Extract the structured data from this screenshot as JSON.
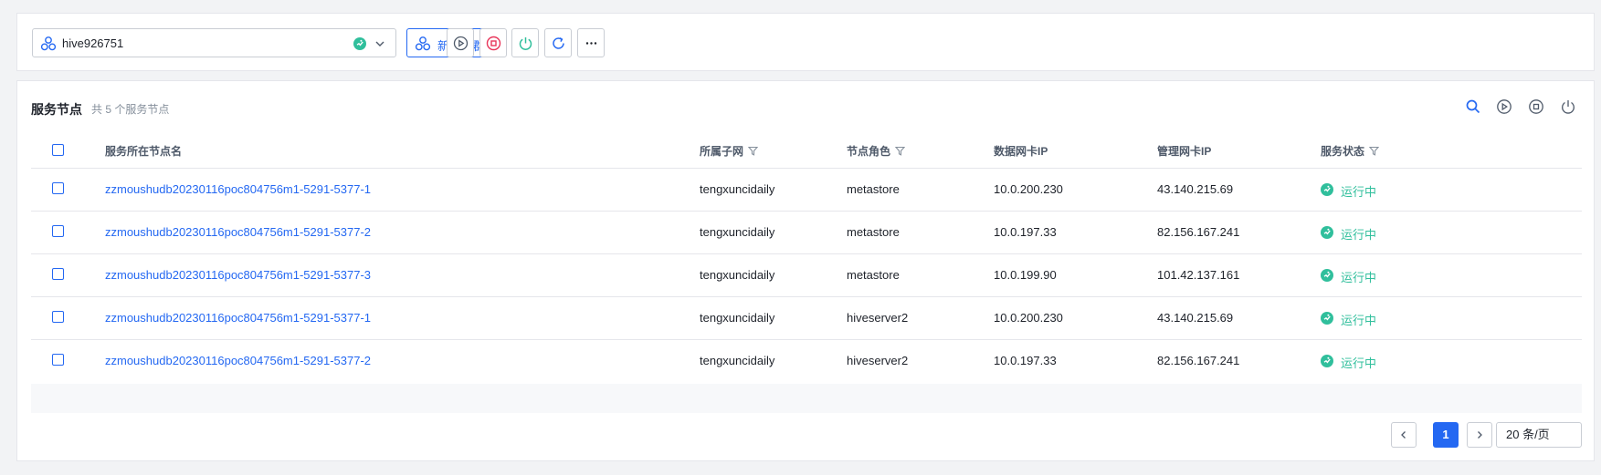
{
  "toolbar": {
    "cluster_name": "hive926751",
    "new_cluster_label": "新建集群",
    "icons": [
      "cluster-icon",
      "running-status-icon",
      "chevron-down-icon",
      "start-icon",
      "stop-icon",
      "power-icon",
      "refresh-icon",
      "more-icon"
    ]
  },
  "panel": {
    "title": "服务节点",
    "count_text": "共 5 个服务节点",
    "tool_icons": [
      "search-icon",
      "start-icon",
      "stop-icon",
      "power-icon"
    ]
  },
  "table": {
    "headers": {
      "node_name": "服务所在节点名",
      "subnet": "所属子网",
      "role": "节点角色",
      "data_ip": "数据网卡IP",
      "mgmt_ip": "管理网卡IP",
      "status": "服务状态"
    },
    "rows": [
      {
        "node_name": "zzmoushudb20230116poc804756m1-5291-5377-1",
        "subnet": "tengxuncidaily",
        "role": "metastore",
        "data_ip": "10.0.200.230",
        "mgmt_ip": "43.140.215.69",
        "status": "运行中"
      },
      {
        "node_name": "zzmoushudb20230116poc804756m1-5291-5377-2",
        "subnet": "tengxuncidaily",
        "role": "metastore",
        "data_ip": "10.0.197.33",
        "mgmt_ip": "82.156.167.241",
        "status": "运行中"
      },
      {
        "node_name": "zzmoushudb20230116poc804756m1-5291-5377-3",
        "subnet": "tengxuncidaily",
        "role": "metastore",
        "data_ip": "10.0.199.90",
        "mgmt_ip": "101.42.137.161",
        "status": "运行中"
      },
      {
        "node_name": "zzmoushudb20230116poc804756m1-5291-5377-1",
        "subnet": "tengxuncidaily",
        "role": "hiveserver2",
        "data_ip": "10.0.200.230",
        "mgmt_ip": "43.140.215.69",
        "status": "运行中"
      },
      {
        "node_name": "zzmoushudb20230116poc804756m1-5291-5377-2",
        "subnet": "tengxuncidaily",
        "role": "hiveserver2",
        "data_ip": "10.0.197.33",
        "mgmt_ip": "82.156.167.241",
        "status": "运行中"
      }
    ]
  },
  "pager": {
    "current_page": "1",
    "page_size": "20 条/页"
  },
  "colors": {
    "primary": "#2468f2",
    "running": "#30bf9c",
    "stop": "#e8355a"
  }
}
